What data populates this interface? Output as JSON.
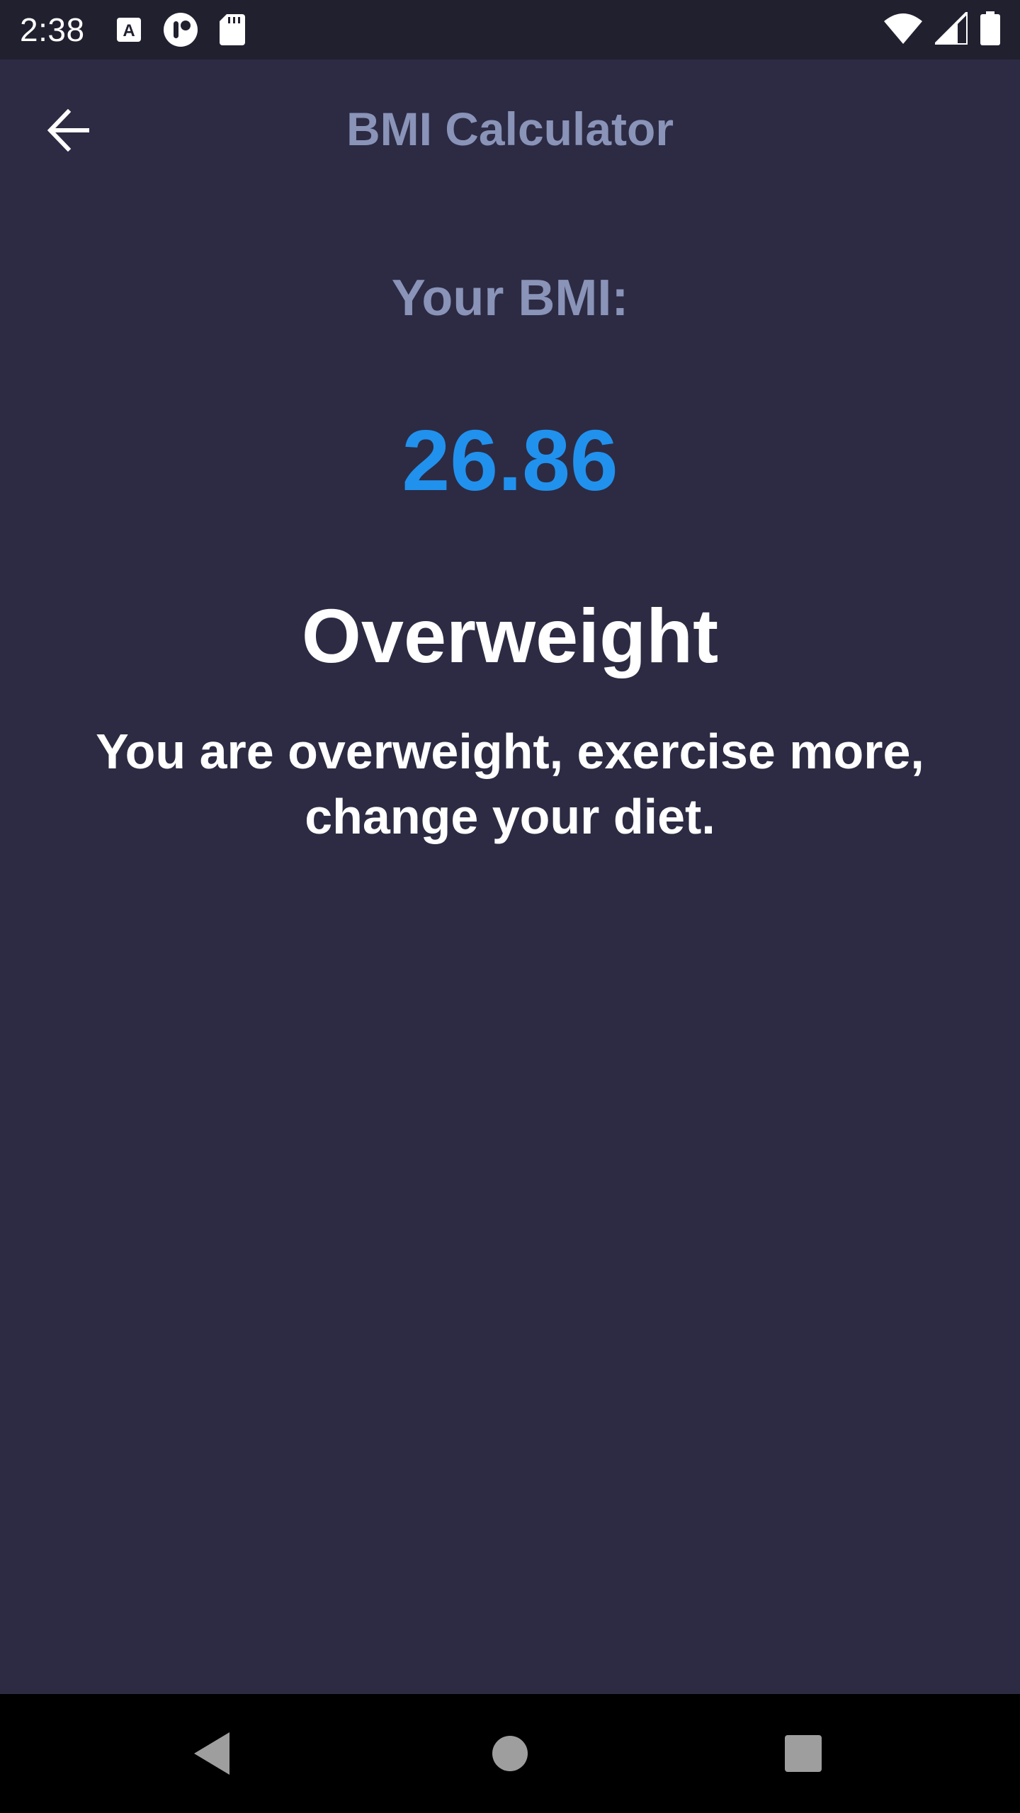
{
  "status_bar": {
    "time": "2:38",
    "icons": [
      "font-a-icon",
      "record-icon",
      "sd-card-icon",
      "wifi-icon",
      "signal-icon",
      "battery-icon"
    ]
  },
  "toolbar": {
    "title": "BMI Calculator",
    "back_icon": "arrow-left-icon"
  },
  "result": {
    "label": "Your BMI:",
    "value": "26.86",
    "category": "Overweight",
    "advice": "You are overweight, exercise more, change your diet."
  },
  "colors": {
    "background": "#2c2b43",
    "status_bar": "#21202f",
    "title": "#8a93b8",
    "value": "#2191ee",
    "text": "#ffffff"
  },
  "nav_bar": {
    "icons": [
      "back-triangle-icon",
      "home-circle-icon",
      "recents-square-icon"
    ]
  }
}
